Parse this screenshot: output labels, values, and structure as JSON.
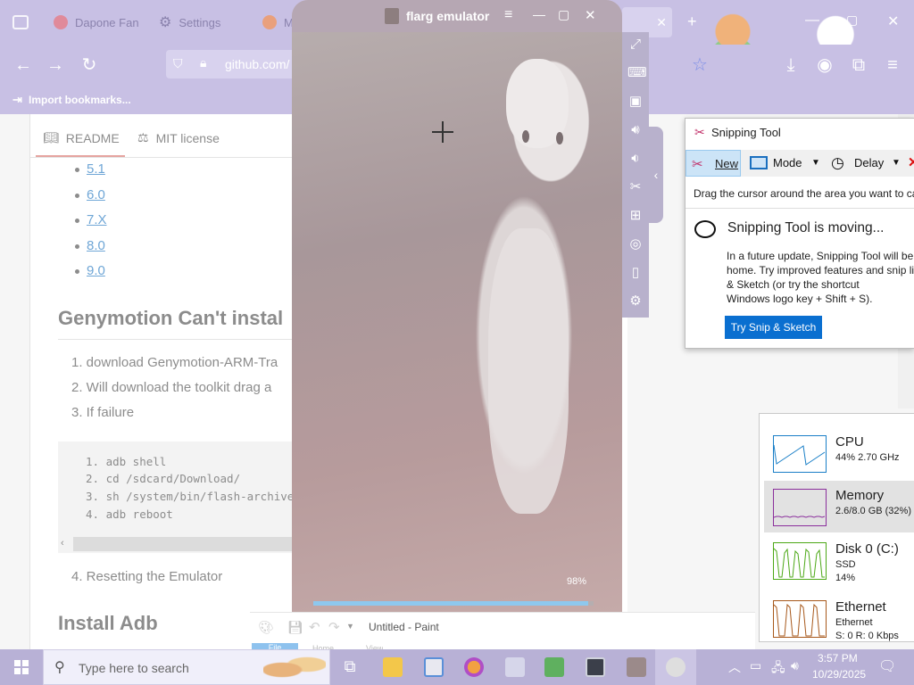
{
  "browser": {
    "tabs": [
      {
        "label": "Dapone Fan"
      },
      {
        "label": "Settings"
      },
      {
        "label": "M"
      }
    ],
    "url": "github.com/",
    "bookmarks_import": "Import bookmarks..."
  },
  "readme": {
    "tabs": [
      "README",
      "MIT license"
    ],
    "versions": [
      "5.1",
      "6.0",
      "7.X",
      "8.0",
      "9.0"
    ],
    "heading1": "Genymotion Can't instal",
    "steps": [
      "1. download Genymotion-ARM-Tra",
      "2. Will download the toolkit drag a",
      "3. If failure"
    ],
    "code_lines": [
      "1. adb shell",
      "2. cd /sdcard/Download/",
      "3. sh /system/bin/flash-archive",
      "4. adb reboot"
    ],
    "step4": "4. Resetting the Emulator",
    "heading2": "Install Adb"
  },
  "emulator": {
    "title": "flarg emulator",
    "progress_label": "98%",
    "progress_fraction": 0.98
  },
  "snipping_tool": {
    "title": "Snipping Tool",
    "new_label": "New",
    "mode_label": "Mode",
    "delay_label": "Delay",
    "hint": "Drag the cursor around the area you want to ca",
    "moving_title": "Snipping Tool is moving...",
    "moving_body": [
      "In a future update, Snipping Tool will be",
      "home. Try improved features and snip lik",
      "& Sketch (or try the shortcut",
      "Windows logo key + Shift + S)."
    ],
    "try_button": "Try Snip & Sketch"
  },
  "performance": {
    "items": [
      {
        "name": "CPU",
        "line1": "44%  2.70 GHz",
        "line2": "",
        "color": "#1a7fc7"
      },
      {
        "name": "Memory",
        "line1": "2.6/8.0 GB (32%)",
        "line2": "",
        "color": "#8b2f9c"
      },
      {
        "name": "Disk 0 (C:)",
        "line1": "SSD",
        "line2": "14%",
        "color": "#4ca816"
      },
      {
        "name": "Ethernet",
        "line1": "Ethernet",
        "line2": "S: 0  R: 0 Kbps",
        "color": "#a7581b"
      }
    ]
  },
  "paint": {
    "title": "Untitled - Paint",
    "tab_file": "File",
    "tab_home": "Home",
    "tab_view": "View"
  },
  "taskbar": {
    "search_placeholder": "Type here to search",
    "time": "3:57 PM",
    "date": "10/29/2025"
  }
}
